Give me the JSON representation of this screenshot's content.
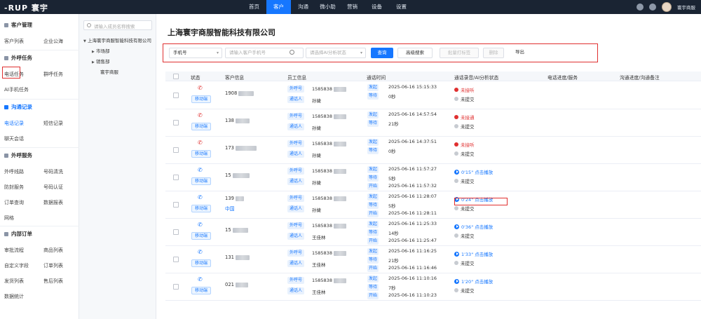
{
  "app": {
    "logo": "-RUP 寰宇",
    "user_name": "寰宇商服"
  },
  "nav": [
    "首页",
    "客户",
    "沟通",
    "微小助",
    "营销",
    "设备",
    "设置"
  ],
  "nav_active": 1,
  "sidebar": {
    "sections": [
      {
        "title": "客户管理",
        "items": [
          [
            "客户列表",
            "企业公海"
          ]
        ]
      },
      {
        "title": "外呼任务",
        "items": [
          [
            "电话任务",
            "群呼任务"
          ],
          [
            "AI手机任务",
            ""
          ]
        ]
      },
      {
        "title": "沟通记录",
        "items": [
          [
            "电话记录",
            "短信记录"
          ],
          [
            "聊天会话",
            ""
          ]
        ]
      },
      {
        "title": "外呼服务",
        "items": [
          [
            "外呼线路",
            "号码清洗"
          ],
          [
            "防封服务",
            "号码认证"
          ],
          [
            "订单查询",
            "数据报表"
          ],
          [
            "网格",
            ""
          ]
        ]
      },
      {
        "title": "内部订单",
        "items": [
          [
            "审批流程",
            "商品列表"
          ],
          [
            "自定义字段",
            "订单列表"
          ],
          [
            "发货列表",
            "售后列表"
          ],
          [
            "数据统计",
            ""
          ]
        ]
      }
    ]
  },
  "tree": {
    "search_placeholder": "请输入成员名称搜索",
    "company": "上海寰宇商服智能科技有限公司",
    "children": [
      "市场部",
      "销售部",
      "寰宇商服"
    ]
  },
  "main": {
    "title": "上海寰宇商服智能科技有限公司",
    "filters": {
      "type": "手机号",
      "search_placeholder": "请输入客户手机号",
      "status_placeholder": "请选择AI分析状态",
      "query": "查询",
      "advanced": "高级搜索",
      "batch": "批量打标签",
      "delete": "删除",
      "export": "导出"
    },
    "columns": [
      "状态",
      "客户信息",
      "员工信息",
      "通话时间",
      "通话录音/AI分析状态",
      "电话进度/服务",
      "沟通进度/沟通备注"
    ],
    "rows": [
      {
        "customer": "1908",
        "customer_tag": "",
        "caller": "1585838",
        "staff": "孙婕",
        "start": "2025-06-16 15:15:33",
        "duration": "0秒",
        "end": "",
        "status_type": "none",
        "status_text": "未接听",
        "ai": "未提交",
        "missed": true
      },
      {
        "customer": "138",
        "customer_tag": "",
        "caller": "1585838",
        "staff": "孙婕",
        "start": "2025-06-16 14:57:54",
        "duration": "21秒",
        "end": "",
        "status_type": "none",
        "status_text": "未接通",
        "ai": "未提交",
        "missed": true
      },
      {
        "customer": "173",
        "customer_tag": "",
        "caller": "1585838",
        "staff": "孙婕",
        "start": "2025-06-16 14:37:51",
        "duration": "0秒",
        "end": "",
        "status_type": "none",
        "status_text": "未接听",
        "ai": "未提交",
        "missed": true
      },
      {
        "customer": "15",
        "customer_tag": "",
        "caller": "1585838",
        "staff": "孙婕",
        "start": "2025-06-16 11:57:27",
        "duration": "5秒",
        "end": "2025-06-16 11:57:32",
        "status_type": "play",
        "status_text": "0'15\" 点击播放",
        "ai": "未提交",
        "missed": false
      },
      {
        "customer": "139",
        "customer_tag": "中国",
        "caller": "1585838",
        "staff": "孙婕",
        "start": "2025-06-16 11:28:07",
        "duration": "5秒",
        "end": "2025-06-16 11:28:11",
        "status_type": "play",
        "status_text": "0'24\" 点击播放",
        "ai": "未提交",
        "missed": false
      },
      {
        "customer": "15",
        "customer_tag": "",
        "caller": "1585838",
        "staff": "王佳林",
        "start": "2025-06-16 11:25:33",
        "duration": "14秒",
        "end": "2025-06-16 11:25:47",
        "status_type": "play",
        "status_text": "0'36\" 点击播放",
        "ai": "未提交",
        "missed": false
      },
      {
        "customer": "131",
        "customer_tag": "",
        "caller": "1585838",
        "staff": "王佳林",
        "start": "2025-06-16 11:16:25",
        "duration": "21秒",
        "end": "2025-06-16 11:16:46",
        "status_type": "play",
        "status_text": "1'33\" 点击播放",
        "ai": "未提交",
        "missed": false
      },
      {
        "customer": "021",
        "customer_tag": "",
        "caller": "1585838",
        "staff": "王佳林",
        "start": "2025-06-16 11:10:16",
        "duration": "7秒",
        "end": "2025-06-16 11:10:23",
        "status_type": "play",
        "status_text": "1'20\" 点击播放",
        "ai": "未提交",
        "missed": false
      }
    ],
    "labels": {
      "outbound": "外呼号",
      "staff": "通话人",
      "start": "发起",
      "duration": "等待",
      "end": "开始",
      "mobile": "移动端"
    }
  }
}
